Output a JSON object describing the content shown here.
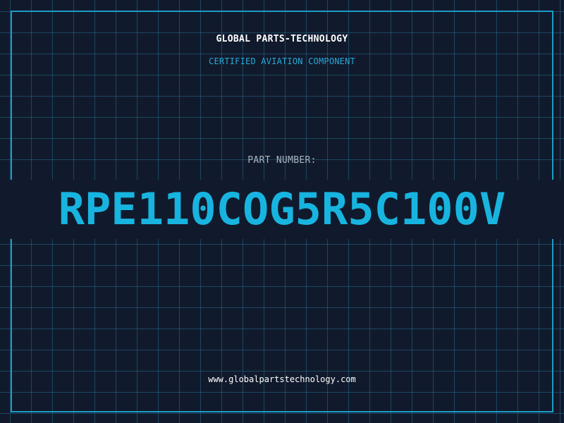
{
  "header": {
    "company": "GLOBAL PARTS-TECHNOLOGY",
    "subtitle": "CERTIFIED AVIATION COMPONENT"
  },
  "part": {
    "label": "PART NUMBER:",
    "number": "RPE110COG5R5C100V"
  },
  "footer": {
    "website": "www.globalpartstechnology.com"
  },
  "colors": {
    "background": "#111a2c",
    "grid": "#2882a5",
    "accent": "#18b4e0",
    "frame": "#1d9bc7"
  }
}
